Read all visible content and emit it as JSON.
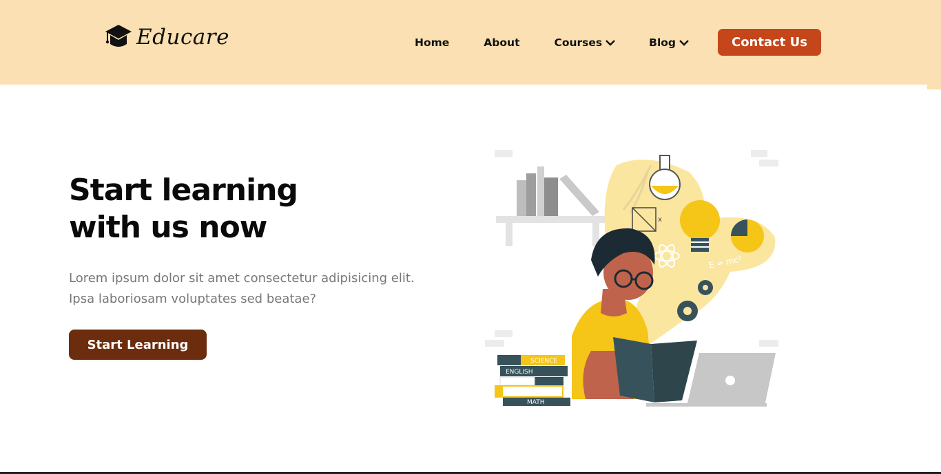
{
  "brand": {
    "name": "Educare",
    "icon": "graduation-cap-icon"
  },
  "nav": {
    "home": "Home",
    "about": "About",
    "courses": "Courses",
    "blog": "Blog",
    "contact": "Contact Us"
  },
  "hero": {
    "title_line1": "Start learning",
    "title_line2": "with us now",
    "desc_line1": "Lorem ipsum dolor sit amet consectetur adipisicing elit.",
    "desc_line2": "Ipsa laboriosam voluptates sed beatae?",
    "cta": "Start Learning"
  },
  "illustration": {
    "book_labels": [
      "SCIENCE",
      "ENGLISH",
      "MATH"
    ],
    "formula": "E = mc²",
    "formula_x": "x"
  },
  "colors": {
    "header_bg": "#fae0b2",
    "contact_button": "#c4461a",
    "cta_button": "#6b2d0d",
    "illustration_yellow": "#f5c518",
    "illustration_teal": "#37525a"
  }
}
